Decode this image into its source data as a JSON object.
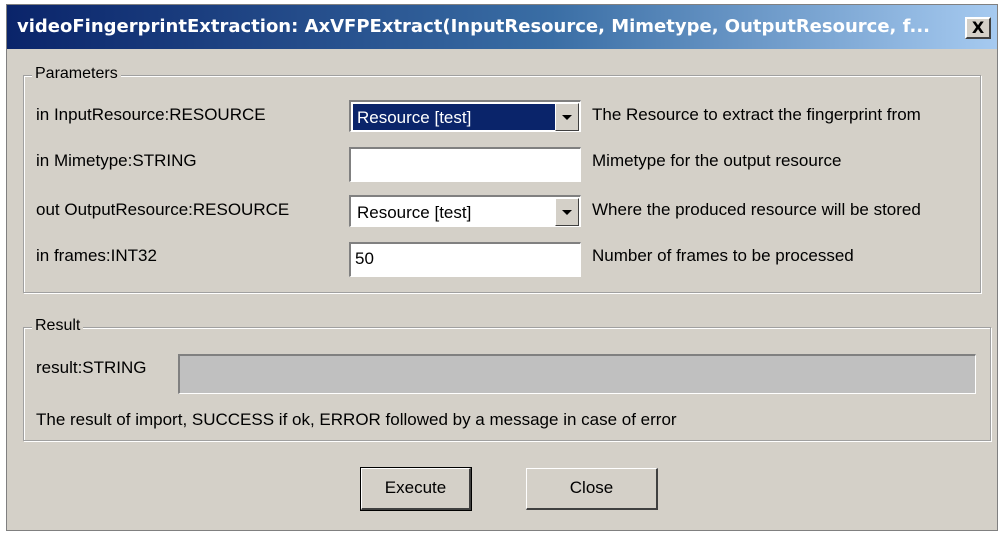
{
  "window": {
    "title": "videoFingerprintExtraction: AxVFPExtract(InputResource, Mimetype, OutputResource, f...",
    "close_glyph": "X"
  },
  "parameters": {
    "legend": "Parameters",
    "rows": [
      {
        "label": "in InputResource:RESOURCE",
        "control": "select",
        "value": "Resource [test]",
        "description": "The Resource to extract the fingerprint from"
      },
      {
        "label": "in Mimetype:STRING",
        "control": "text",
        "value": "",
        "description": "Mimetype for the output resource"
      },
      {
        "label": "out OutputResource:RESOURCE",
        "control": "select",
        "value": "Resource [test]",
        "description": "Where the produced resource will be stored"
      },
      {
        "label": "in frames:INT32",
        "control": "text",
        "value": "50",
        "description": "Number of frames to be processed"
      }
    ]
  },
  "result": {
    "legend": "Result",
    "label": "result:STRING",
    "value": "",
    "description": "The result of import, SUCCESS if ok, ERROR followed by a message in case of error"
  },
  "buttons": {
    "execute": "Execute",
    "close": "Close"
  },
  "icons": {
    "close": "close-icon",
    "dropdown": "chevron-down-icon"
  },
  "colors": {
    "titlebar_start": "#0a246a",
    "titlebar_end": "#a6caf0",
    "face": "#d4d0c8",
    "selection": "#0a246a"
  }
}
